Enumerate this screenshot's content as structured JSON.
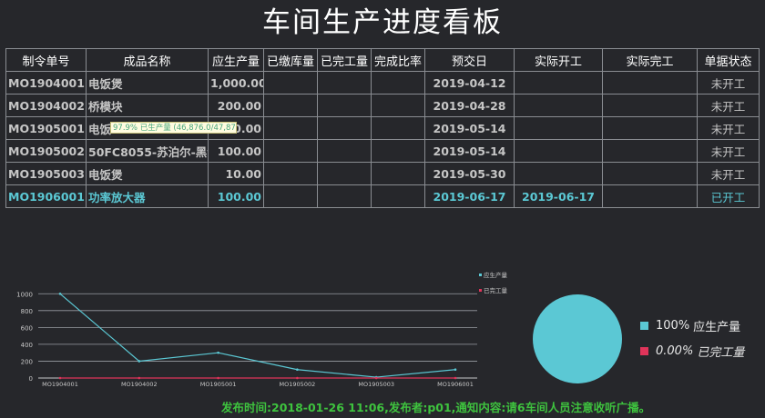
{
  "title": "车间生产进度看板",
  "table": {
    "columns": [
      "制令单号",
      "成品名称",
      "应生产量",
      "已缴库量",
      "已完工量",
      "完成比率",
      "预交日",
      "实际开工",
      "实际完工",
      "单据状态"
    ],
    "rows": [
      {
        "order": "MO1904001",
        "product": "电饭煲",
        "planned": "1,000.00",
        "stocked": "",
        "completed": "",
        "ratio": "",
        "due": "2019-04-12",
        "actual_start": "",
        "actual_finish": "",
        "status": "未开工"
      },
      {
        "order": "MO1904002",
        "product": "桥模块",
        "planned": "200.00",
        "stocked": "",
        "completed": "",
        "ratio": "",
        "due": "2019-04-28",
        "actual_start": "",
        "actual_finish": "",
        "status": "未开工"
      },
      {
        "order": "MO1905001",
        "product": "电饭",
        "planned": "0.00",
        "stocked": "",
        "completed": "",
        "ratio": "",
        "due": "2019-05-14",
        "actual_start": "",
        "actual_finish": "",
        "status": "未开工"
      },
      {
        "order": "MO1905002",
        "product": "50FC8055-苏泊尔-黑色",
        "planned": "100.00",
        "stocked": "",
        "completed": "",
        "ratio": "",
        "due": "2019-05-14",
        "actual_start": "",
        "actual_finish": "",
        "status": "未开工"
      },
      {
        "order": "MO1905003",
        "product": "电饭煲",
        "planned": "10.00",
        "stocked": "",
        "completed": "",
        "ratio": "",
        "due": "2019-05-30",
        "actual_start": "",
        "actual_finish": "",
        "status": "未开工"
      },
      {
        "order": "MO1906001",
        "product": "功率放大器",
        "planned": "100.00",
        "stocked": "",
        "completed": "",
        "ratio": "",
        "due": "2019-06-17",
        "actual_start": "2019-06-17",
        "actual_finish": "",
        "status": "已开工"
      }
    ]
  },
  "tooltip": {
    "text": "97.9% 已生产量 (46,876.0/47,876)"
  },
  "colors": {
    "background": "#26272b",
    "planned": "#5bc8d4",
    "completed": "#e0345a",
    "active_row": "#5bc8d4",
    "notice": "#3ec33e"
  },
  "chart_data": [
    {
      "type": "line",
      "categories": [
        "MO1904001",
        "MO1904002",
        "MO1905001",
        "MO1905002",
        "MO1905003",
        "MO1906001"
      ],
      "series": [
        {
          "name": "应生产量",
          "values": [
            1000,
            200,
            300,
            100,
            10,
            100
          ],
          "color": "#5bc8d4"
        },
        {
          "name": "已完工量",
          "values": [
            0,
            0,
            0,
            0,
            0,
            0
          ],
          "color": "#e0345a"
        }
      ],
      "yticks": [
        0,
        200,
        400,
        600,
        800,
        1000
      ],
      "ylim": [
        0,
        1100
      ],
      "grid": true,
      "legend": "top-right"
    },
    {
      "type": "pie",
      "slices": [
        {
          "name": "应生产量",
          "percent": "100%",
          "value": 100,
          "color": "#5bc8d4"
        },
        {
          "name": "已完工量",
          "percent": "0.00%",
          "value": 0,
          "color": "#e0345a"
        }
      ],
      "legend": "right"
    }
  ],
  "notice": {
    "text": "发布时间:2018-01-26 11:06,发布者:p01,通知内容:请6车间人员注意收听广播。"
  }
}
